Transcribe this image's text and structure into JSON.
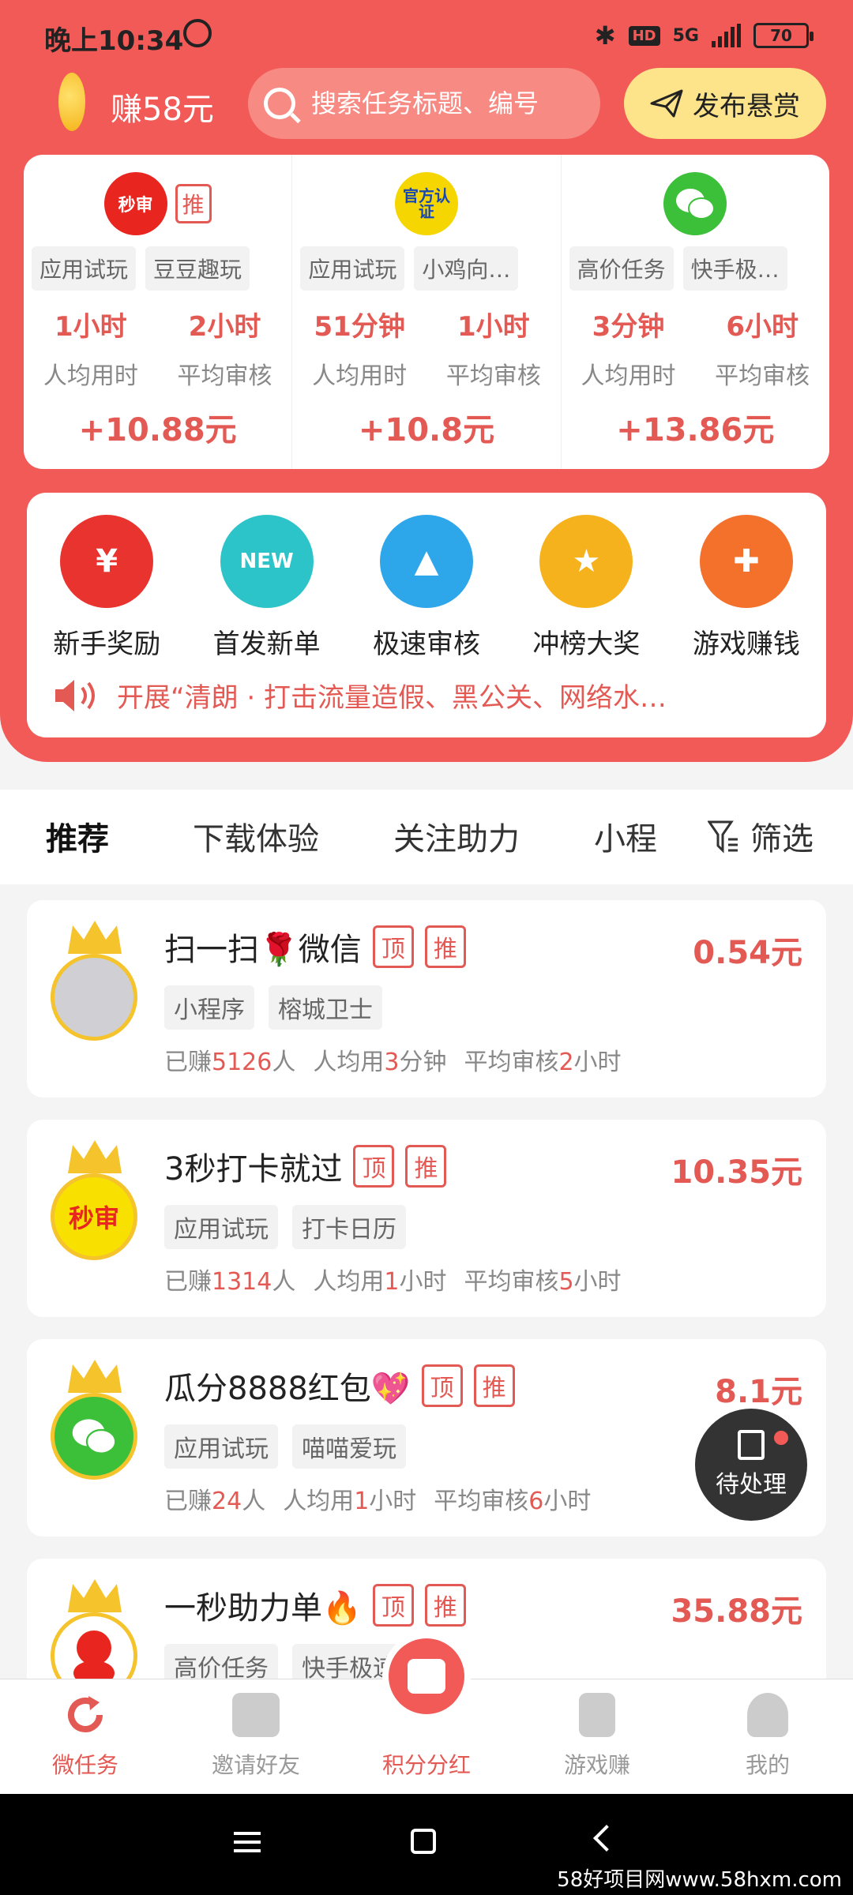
{
  "status_bar": {
    "time": "晚上10:34",
    "network": "5G",
    "hd": "HD",
    "battery": "70"
  },
  "header": {
    "earn_label": "赚58元",
    "search_placeholder": "搜索任务标题、编号",
    "publish_label": "发布悬赏"
  },
  "task_cards": [
    {
      "icon_text": "秒审",
      "icon_color": "#e8261f",
      "badge": "推",
      "tags": [
        "应用试玩",
        "豆豆趣玩"
      ],
      "time1": "1小时",
      "time1_label": "人均用时",
      "time2": "2小时",
      "time2_label": "平均审核",
      "reward": "+10.88元"
    },
    {
      "icon_text": "官方认证",
      "icon_color": "#f5d600",
      "badge": "",
      "tags": [
        "应用试玩",
        "小鸡向…"
      ],
      "time1": "51分钟",
      "time1_label": "人均用时",
      "time2": "1小时",
      "time2_label": "平均审核",
      "reward": "+10.8元"
    },
    {
      "icon_text": "",
      "icon_color": "#3cc03a",
      "badge": "",
      "tags": [
        "高价任务",
        "快手极…"
      ],
      "time1": "3分钟",
      "time1_label": "人均用时",
      "time2": "6小时",
      "time2_label": "平均审核",
      "reward": "+13.86元"
    }
  ],
  "menu": {
    "items": [
      {
        "label": "新手奖励",
        "color": "#e8332e",
        "icon": "red-envelope-icon",
        "glyph": "¥"
      },
      {
        "label": "首发新单",
        "color": "#2cc4c9",
        "icon": "new-badge-icon",
        "glyph": "NEW"
      },
      {
        "label": "极速审核",
        "color": "#2ea6ea",
        "icon": "stamp-icon",
        "glyph": "▲"
      },
      {
        "label": "冲榜大奖",
        "color": "#f6b21c",
        "icon": "trophy-icon",
        "glyph": "★"
      },
      {
        "label": "游戏赚钱",
        "color": "#f3712b",
        "icon": "gamepad-icon",
        "glyph": "✚"
      }
    ],
    "notice": "开展“清朗 · 打击流量造假、黑公关、网络水…"
  },
  "tabs": {
    "items": [
      "推荐",
      "下载体验",
      "关注助力",
      "小程"
    ],
    "filter": "筛选"
  },
  "list": [
    {
      "title": "扫一扫🌹微信",
      "badges": [
        "顶",
        "推"
      ],
      "price": "0.54元",
      "tags": [
        "小程序",
        "榕城卫士"
      ],
      "earned_prefix": "已赚",
      "earned": "5126",
      "earned_suffix": "人",
      "avg_prefix": "人均用",
      "avg": "3",
      "avg_suffix": "分钟",
      "review_prefix": "平均审核",
      "review": "2",
      "review_suffix": "小时",
      "avatar_text": "",
      "avatar_color": "#cfcfd4"
    },
    {
      "title": "3秒打卡就过",
      "badges": [
        "顶",
        "推"
      ],
      "price": "10.35元",
      "tags": [
        "应用试玩",
        "打卡日历"
      ],
      "earned_prefix": "已赚",
      "earned": "1314",
      "earned_suffix": "人",
      "avg_prefix": "人均用",
      "avg": "1",
      "avg_suffix": "小时",
      "review_prefix": "平均审核",
      "review": "5",
      "review_suffix": "小时",
      "avatar_text": "秒审",
      "avatar_color": "#f8e000"
    },
    {
      "title": "瓜分8888红包💖",
      "badges": [
        "顶",
        "推"
      ],
      "price": "8.1元",
      "tags": [
        "应用试玩",
        "喵喵爱玩"
      ],
      "earned_prefix": "已赚",
      "earned": "24",
      "earned_suffix": "人",
      "avg_prefix": "人均用",
      "avg": "1",
      "avg_suffix": "小时",
      "review_prefix": "平均审核",
      "review": "6",
      "review_suffix": "小时",
      "avatar_text": "",
      "avatar_color": "#3cc03a"
    },
    {
      "title": "一秒助力单🔥",
      "badges": [
        "顶",
        "推"
      ],
      "price": "35.88元",
      "tags": [
        "高价任务",
        "快手极速版"
      ],
      "earned_prefix": "",
      "earned": "",
      "earned_suffix": "",
      "avg_prefix": "",
      "avg": "",
      "avg_suffix": "",
      "review_prefix": "",
      "review": "",
      "review_suffix": "",
      "avatar_text": "",
      "avatar_color": "#e8261f"
    }
  ],
  "pending": {
    "label": "待处理"
  },
  "bottom_nav": [
    "微任务",
    "邀请好友",
    "积分分红",
    "游戏赚",
    "我的"
  ],
  "watermark": "58好项目网www.58hxm.com",
  "colors": {
    "brand": "#f25a57",
    "accent_text": "#e35a55",
    "publish_bg": "#fde48a"
  }
}
